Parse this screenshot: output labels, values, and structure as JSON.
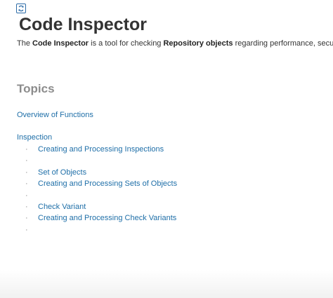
{
  "header": {
    "icon": "sync-icon",
    "title": "Code Inspector"
  },
  "intro": {
    "prefix": "The ",
    "bold_1": "Code Inspector",
    "middle": " is a tool for checking ",
    "bold_2": "Repository objects",
    "suffix": " regarding performance, security, syn"
  },
  "topics": {
    "heading": "Topics",
    "overview_link": "Overview of Functions",
    "inspection_link": "Inspection",
    "bullet_glyph": "·",
    "items": [
      {
        "label": "Creating and Processing Inspections"
      },
      {
        "label": ""
      },
      {
        "label": "Set of Objects"
      },
      {
        "label": "Creating and Processing Sets of Objects"
      },
      {
        "label": ""
      },
      {
        "label": "Check Variant"
      },
      {
        "label": "Creating and Processing Check Variants"
      },
      {
        "label": ""
      }
    ]
  },
  "colors": {
    "link": "#1f6fa8",
    "title": "#333333",
    "heading": "#8c8c8c",
    "icon_border": "#2d6ca8"
  }
}
